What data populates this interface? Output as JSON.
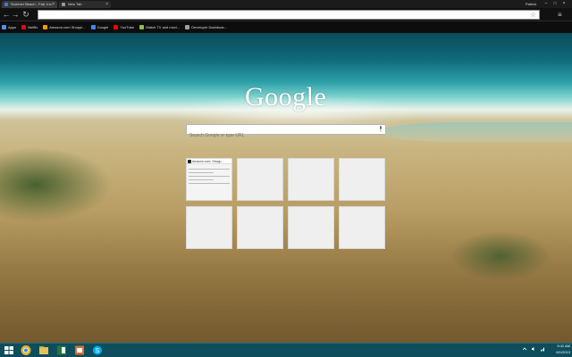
{
  "browser": {
    "tabs": [
      {
        "title": "Summer Beach - Fab. Inc.",
        "favicon_color": "#3c7dd9"
      },
      {
        "title": "New Tab",
        "favicon_color": "#999999"
      }
    ],
    "profile_name": "Patrick",
    "window_controls": [
      "–",
      "□",
      "×"
    ],
    "tab_close": "×",
    "nav": {
      "back": "←",
      "forward": "→",
      "reload": "↻"
    },
    "omnibox_value": "",
    "star": "☆",
    "menu": "≡"
  },
  "bookmarks": [
    {
      "label": "Apps",
      "color": "#5b8def"
    },
    {
      "label": "Netflix",
      "color": "#e50914"
    },
    {
      "label": "Amazon.com Shoppi...",
      "color": "#ff9900"
    },
    {
      "label": "Google",
      "color": "#4285f4"
    },
    {
      "label": "YouTube",
      "color": "#ff0000"
    },
    {
      "label": "Watch TV and movi...",
      "color": "#8bc34a"
    },
    {
      "label": "Developer Dashboar...",
      "color": "#9e9e9e"
    }
  ],
  "new_tab": {
    "logo": "Google",
    "search_placeholder": "Search Google or type URL",
    "tiles": [
      {
        "title": "Amazon.com: Shopp..."
      },
      {
        "title": ""
      },
      {
        "title": ""
      },
      {
        "title": ""
      },
      {
        "title": ""
      },
      {
        "title": ""
      },
      {
        "title": ""
      },
      {
        "title": ""
      }
    ]
  },
  "taskbar": {
    "time": "9:41 AM",
    "date": "8/1/2013",
    "apps": [
      {
        "name": "windows-start-icon",
        "color": "#ffffff"
      },
      {
        "name": "chrome-icon",
        "color": "#e5b52a"
      },
      {
        "name": "file-explorer-icon",
        "color": "#e8c05a"
      },
      {
        "name": "excel-icon",
        "color": "#1f7a3d"
      },
      {
        "name": "outlook-icon",
        "color": "#e06c2c"
      },
      {
        "name": "skype-icon",
        "color": "#00aff0"
      }
    ]
  }
}
